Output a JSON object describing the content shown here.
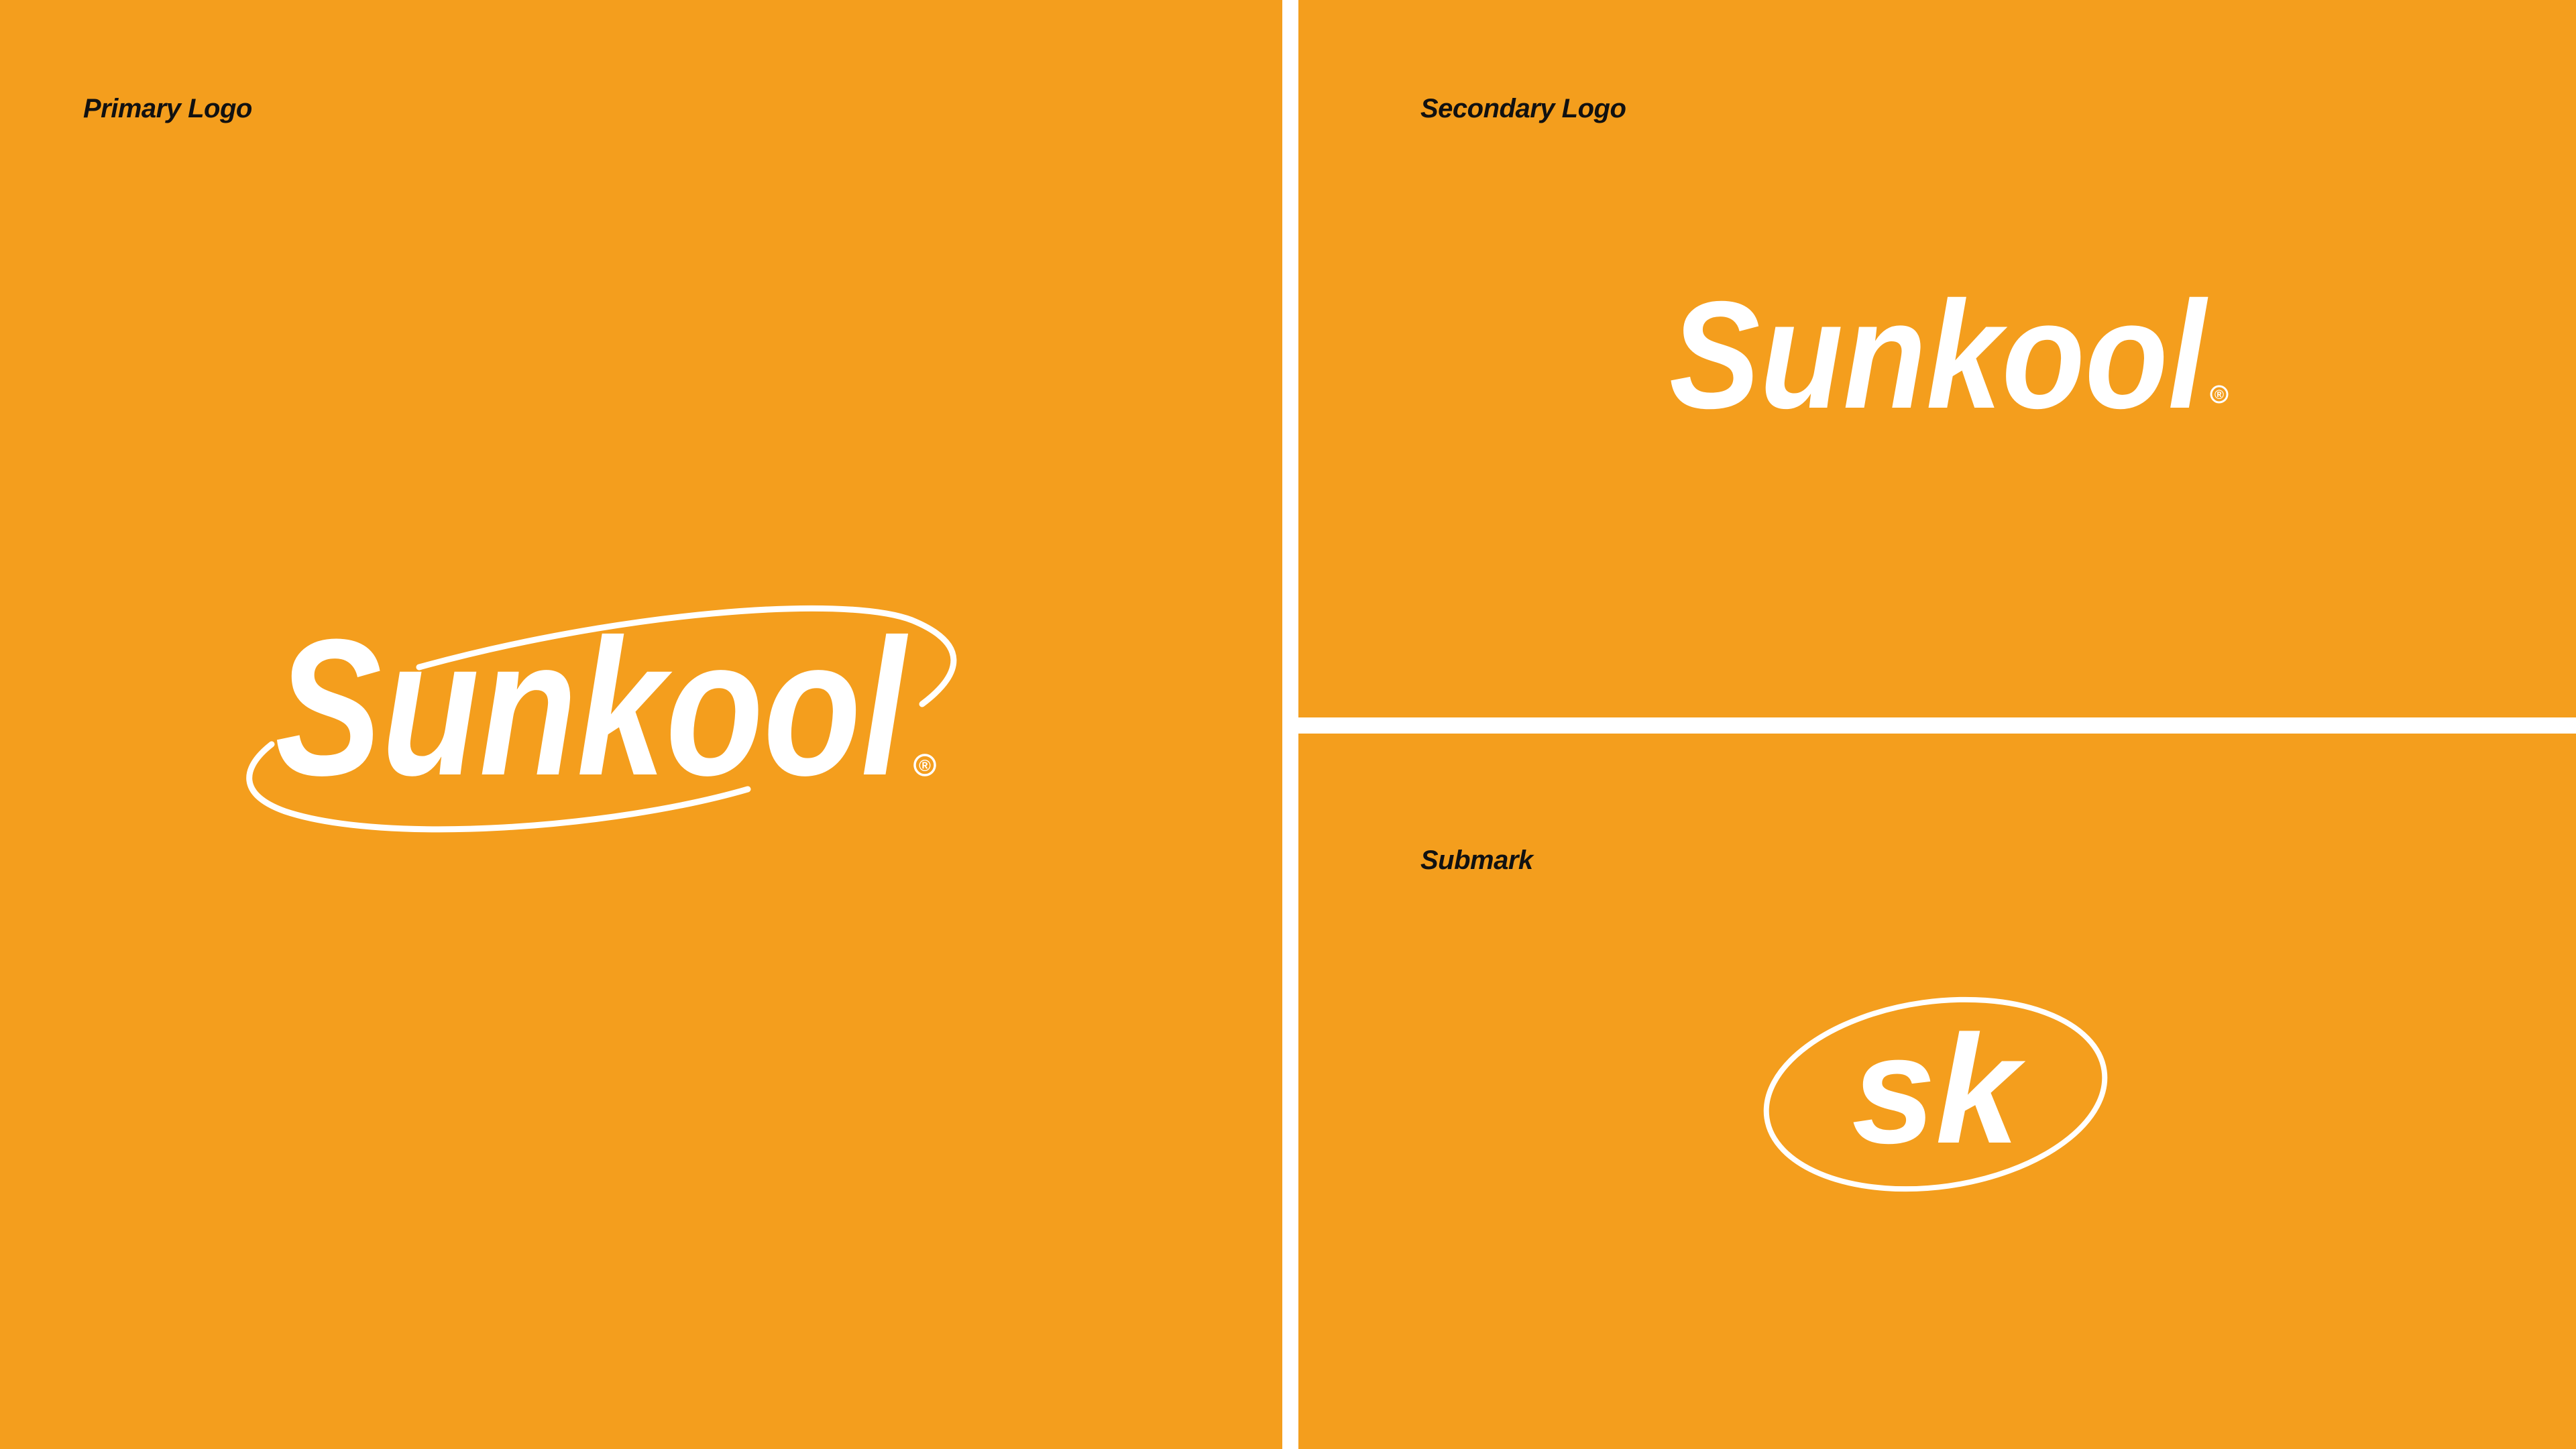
{
  "colors": {
    "panel_background": "#f49e1d",
    "divider": "#ffffff",
    "logo": "#ffffff",
    "label_text": "#111111"
  },
  "panels": {
    "primary": {
      "label": "Primary Logo",
      "logo_text": "Sunkool",
      "registered_mark": "®"
    },
    "secondary": {
      "label": "Secondary Logo",
      "logo_text": "Sunkool",
      "registered_mark": "®"
    },
    "submark": {
      "label": "Submark",
      "logo_text": "sk"
    }
  }
}
